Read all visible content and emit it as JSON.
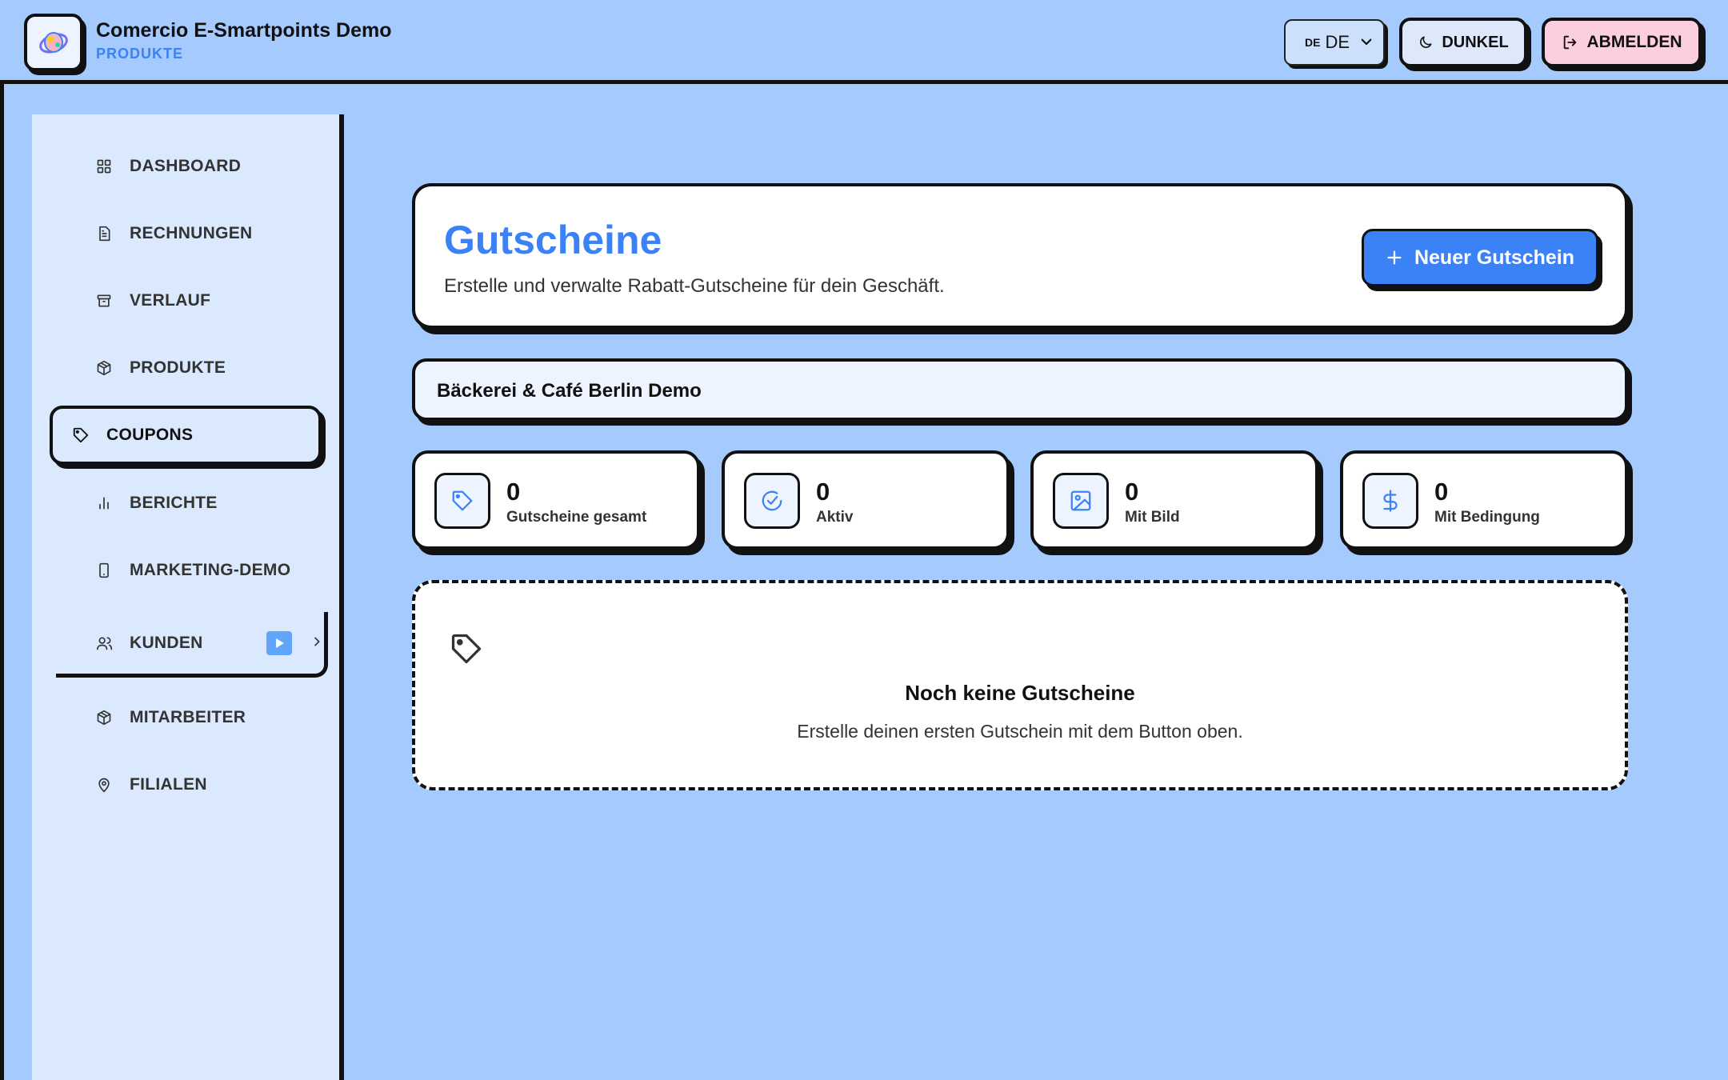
{
  "header": {
    "app_title": "Comercio E-Smartpoints Demo",
    "app_subtitle": "PRODUKTE",
    "language": {
      "code": "DE",
      "selected": "DE"
    },
    "theme_label": "DUNKEL",
    "logout_label": "ABMELDEN"
  },
  "sidebar": {
    "items": [
      {
        "label": "DASHBOARD",
        "icon": "grid-icon"
      },
      {
        "label": "RECHNUNGEN",
        "icon": "document-icon"
      },
      {
        "label": "VERLAUF",
        "icon": "archive-icon"
      },
      {
        "label": "PRODUKTE",
        "icon": "box-icon"
      },
      {
        "label": "COUPONS",
        "icon": "tag-icon",
        "active": true
      },
      {
        "label": "BERICHTE",
        "icon": "bar-chart-icon"
      },
      {
        "label": "MARKETING-DEMO",
        "icon": "phone-icon"
      },
      {
        "label": "KUNDEN",
        "icon": "users-icon"
      },
      {
        "label": "MITARBEITER",
        "icon": "box-icon"
      },
      {
        "label": "FILIALEN",
        "icon": "map-pin-icon"
      }
    ]
  },
  "main": {
    "title": "Gutscheine",
    "description": "Erstelle und verwalte Rabatt-Gutscheine für dein Geschäft.",
    "new_button_label": "Neuer Gutschein",
    "store_name": "Bäckerei & Café Berlin Demo",
    "stats": [
      {
        "value": "0",
        "label": "Gutscheine gesamt",
        "icon": "tag-icon"
      },
      {
        "value": "0",
        "label": "Aktiv",
        "icon": "check-circle-icon"
      },
      {
        "value": "0",
        "label": "Mit Bild",
        "icon": "image-icon"
      },
      {
        "value": "0",
        "label": "Mit Bedingung",
        "icon": "dollar-icon"
      }
    ],
    "empty_state": {
      "title": "Noch keine Gutscheine",
      "text": "Erstelle deinen ersten Gutschein mit dem Button oben."
    }
  },
  "colors": {
    "background": "#a4cafe",
    "sidebar": "#dbe9fe",
    "accent": "#3b82f6",
    "logout": "#fbcfe0"
  }
}
